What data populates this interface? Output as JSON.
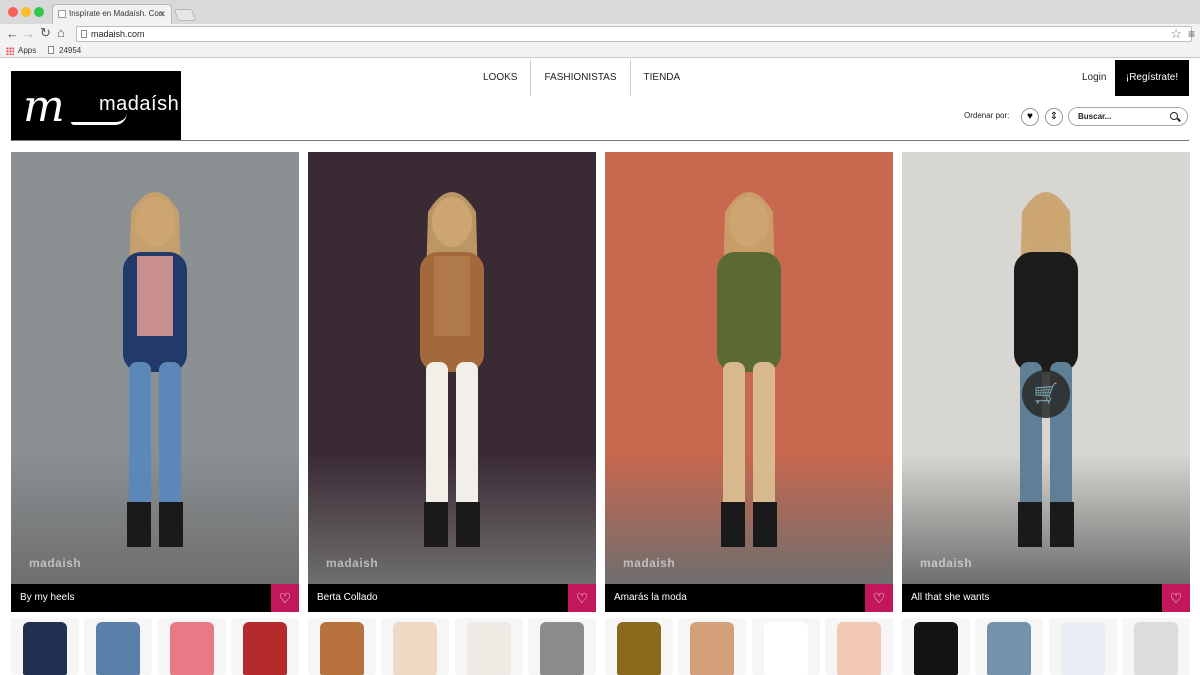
{
  "browser": {
    "tab_title": "Inspírate en Madaísh. Con",
    "url": "madaish.com",
    "bookmarks": [
      "Apps",
      "24954"
    ]
  },
  "site": {
    "logo_text": "madaísh",
    "nav": [
      "LOOKS",
      "FASHIONISTAS",
      "TIENDA"
    ],
    "login": "Login",
    "register": "¡Regístrate!",
    "sort_label": "Ordenar por:",
    "search_placeholder": "Buscar..."
  },
  "looks": [
    {
      "title": "By my heels",
      "watermark": "madaish",
      "colors": {
        "bg": "#8a8f92",
        "top": "#c98f8f",
        "coat": "#223a6a",
        "pants": "#5b88b8"
      }
    },
    {
      "title": "Berta Collado",
      "watermark": "madaish",
      "colors": {
        "bg": "#3a2a34",
        "top": "#b07a4a",
        "coat": "#a4693b",
        "pants": "#f2efe8"
      }
    },
    {
      "title": "Amarás la moda",
      "watermark": "madaish",
      "colors": {
        "bg": "#c8684f",
        "top": "#5b6a32",
        "coat": "#5b6a32",
        "pants": "#d8b98e"
      }
    },
    {
      "title": "All that she wants",
      "watermark": "madaish",
      "colors": {
        "bg": "#d8d6d1",
        "top": "#1c1c1c",
        "coat": "#1c1c1c",
        "pants": "#5e7f96"
      }
    }
  ],
  "products": [
    [
      "#1f3050",
      "#5a7fa8",
      "#e87a86",
      "#b52a2a"
    ],
    [
      "#b8723e",
      "#f0d9c4",
      "#efeae4",
      "#8c8c8c"
    ],
    [
      "#8b6a1e",
      "#d4a07a",
      "#ffffff",
      "#f0c8b4"
    ],
    [
      "#141414",
      "#7592ad",
      "#e9eef4",
      "#dcdcdc"
    ]
  ]
}
